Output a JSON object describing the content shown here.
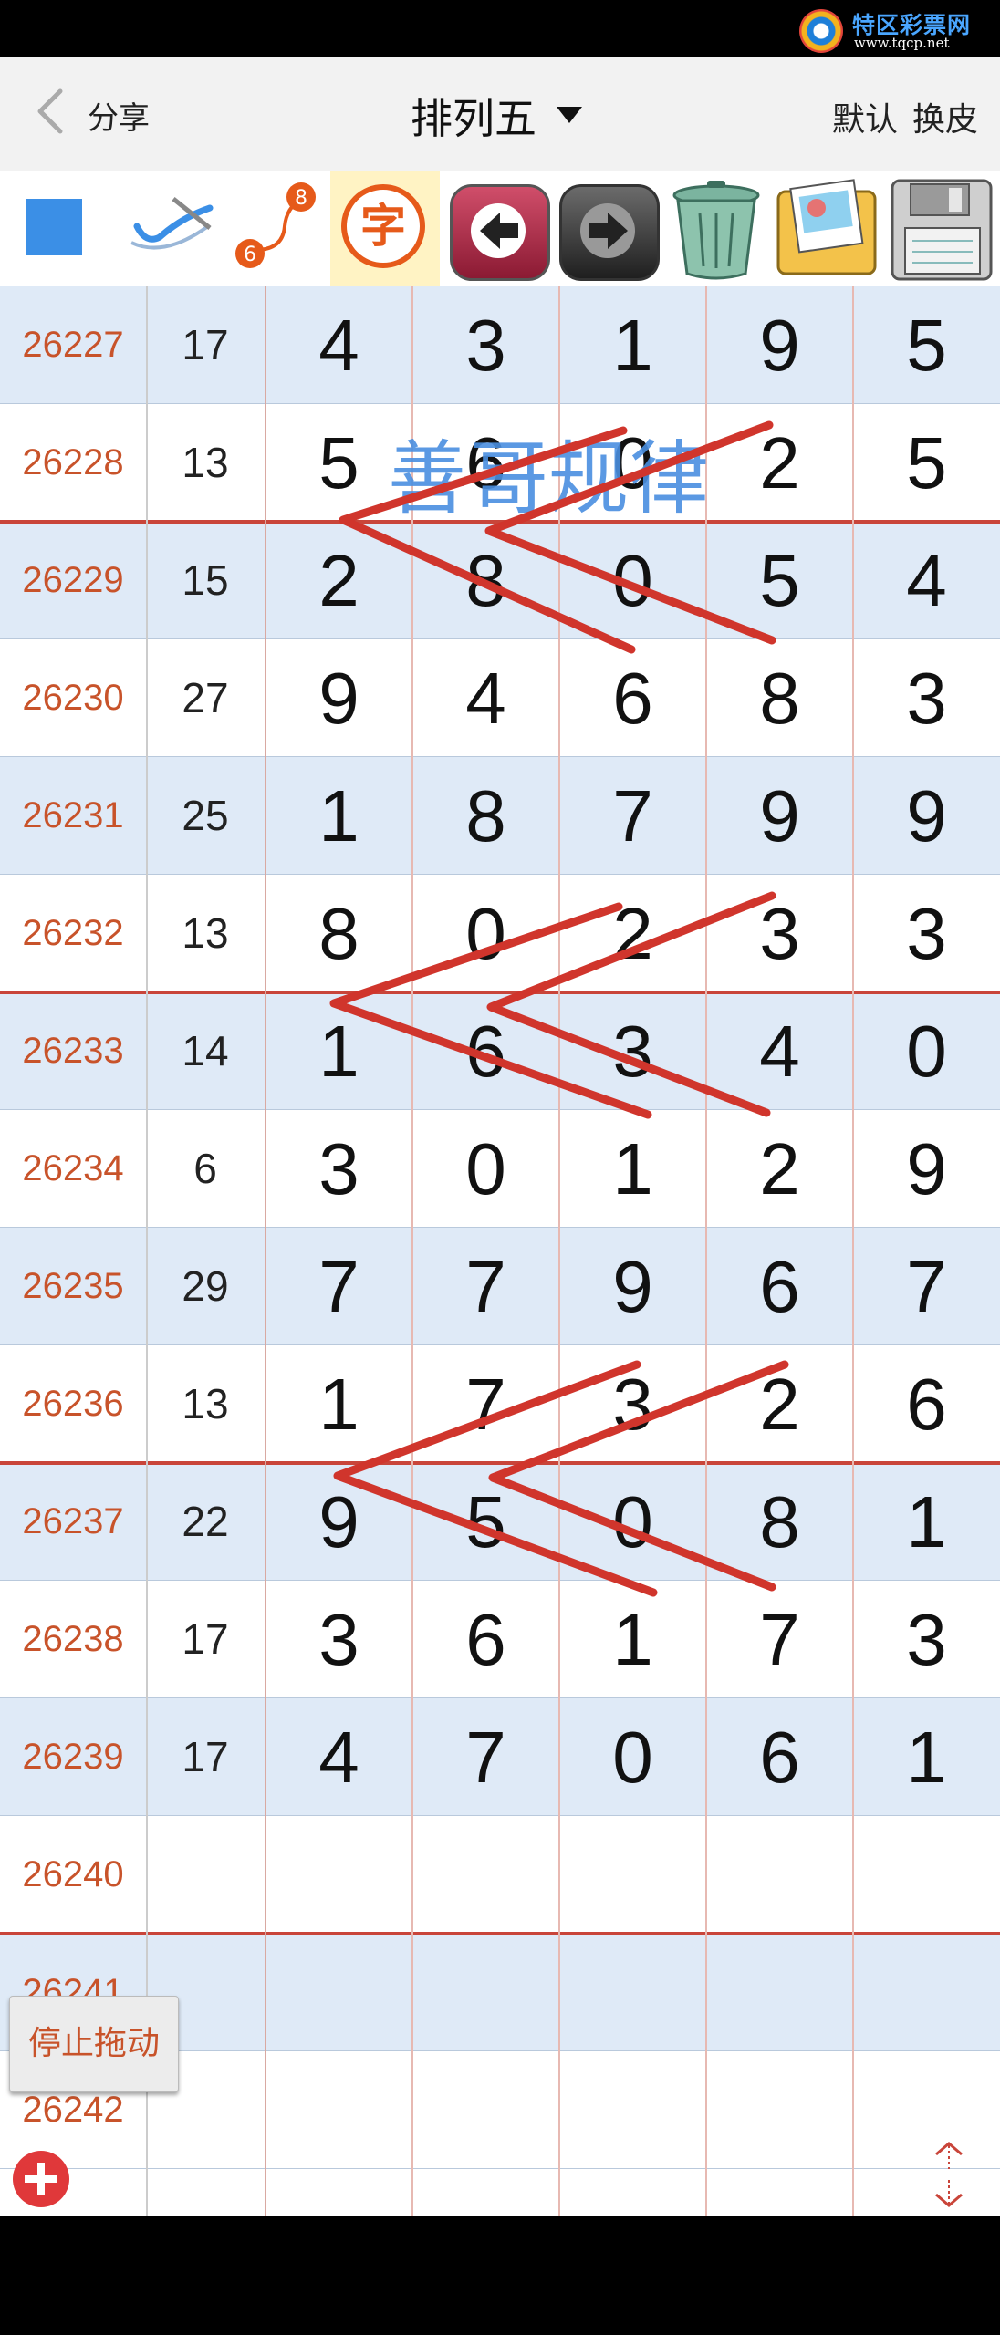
{
  "watermark_site": {
    "name": "特区彩票网",
    "url": "www.tqcp.net"
  },
  "header": {
    "back_label": "分享",
    "title": "排列五",
    "default_label": "默认",
    "skin_label": "换皮"
  },
  "toolbar": {
    "icons": [
      "blue-square-icon",
      "pen-check-icon",
      "curve-6-8-icon",
      "zi-character-icon",
      "arrow-left-icon",
      "arrow-right-icon",
      "trash-icon",
      "photo-album-icon",
      "save-floppy-icon"
    ],
    "zi_char": "字",
    "curve_top": "8",
    "curve_bottom": "6"
  },
  "watermark_text": "善哥规律",
  "table": {
    "rows": [
      {
        "issue": "26227",
        "sum": "17",
        "digits": [
          "4",
          "3",
          "1",
          "9",
          "5"
        ]
      },
      {
        "issue": "26228",
        "sum": "13",
        "digits": [
          "5",
          "6",
          "0",
          "2",
          "5"
        ]
      },
      {
        "issue": "26229",
        "sum": "15",
        "digits": [
          "2",
          "8",
          "0",
          "5",
          "4"
        ]
      },
      {
        "issue": "26230",
        "sum": "27",
        "digits": [
          "9",
          "4",
          "6",
          "8",
          "3"
        ]
      },
      {
        "issue": "26231",
        "sum": "25",
        "digits": [
          "1",
          "8",
          "7",
          "9",
          "9"
        ]
      },
      {
        "issue": "26232",
        "sum": "13",
        "digits": [
          "8",
          "0",
          "2",
          "3",
          "3"
        ]
      },
      {
        "issue": "26233",
        "sum": "14",
        "digits": [
          "1",
          "6",
          "3",
          "4",
          "0"
        ]
      },
      {
        "issue": "26234",
        "sum": "6",
        "digits": [
          "3",
          "0",
          "1",
          "2",
          "9"
        ]
      },
      {
        "issue": "26235",
        "sum": "29",
        "digits": [
          "7",
          "7",
          "9",
          "6",
          "7"
        ]
      },
      {
        "issue": "26236",
        "sum": "13",
        "digits": [
          "1",
          "7",
          "3",
          "2",
          "6"
        ]
      },
      {
        "issue": "26237",
        "sum": "22",
        "digits": [
          "9",
          "5",
          "0",
          "8",
          "1"
        ]
      },
      {
        "issue": "26238",
        "sum": "17",
        "digits": [
          "3",
          "6",
          "1",
          "7",
          "3"
        ]
      },
      {
        "issue": "26239",
        "sum": "17",
        "digits": [
          "4",
          "7",
          "0",
          "6",
          "1"
        ]
      },
      {
        "issue": "26240",
        "sum": "",
        "digits": [
          "",
          "",
          "",
          "",
          ""
        ]
      },
      {
        "issue": "26241",
        "sum": "",
        "digits": [
          "",
          "",
          "",
          "",
          ""
        ]
      },
      {
        "issue": "26242",
        "sum": "",
        "digits": [
          "",
          "",
          "",
          "",
          ""
        ]
      }
    ]
  },
  "stop_drag_label": "停止拖动",
  "colors": {
    "accent": "#c9453a",
    "shade": "#dfeaf7",
    "issue_text": "#c8532a",
    "watermark": "#4a8fe0",
    "blue": "#3b8fe6"
  }
}
